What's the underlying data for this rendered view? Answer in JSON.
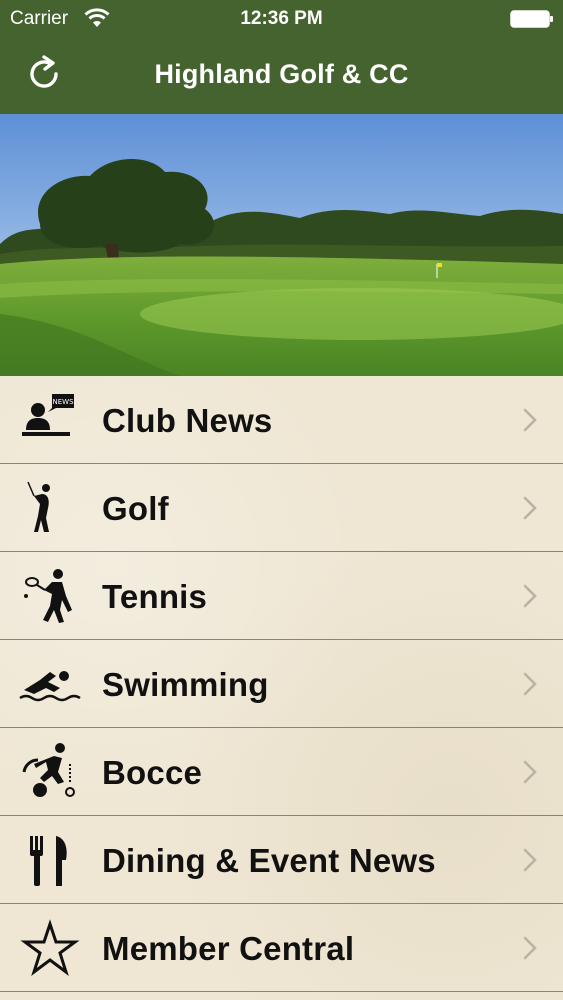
{
  "status_bar": {
    "carrier": "Carrier",
    "time": "12:36 PM",
    "wifi_icon": "wifi-icon",
    "battery_icon": "battery-icon"
  },
  "nav_bar": {
    "title": "Highland Golf & CC",
    "refresh_icon": "refresh-icon",
    "color": "#45632e"
  },
  "hero": {
    "image": "golf-course-photo"
  },
  "menu": {
    "items": [
      {
        "label": "Club News",
        "icon": "news-icon"
      },
      {
        "label": "Golf",
        "icon": "golfer-icon"
      },
      {
        "label": "Tennis",
        "icon": "tennis-player-icon"
      },
      {
        "label": "Swimming",
        "icon": "swimmer-icon"
      },
      {
        "label": "Bocce",
        "icon": "bocce-player-icon"
      },
      {
        "label": "Dining & Event News",
        "icon": "fork-knife-icon"
      },
      {
        "label": "Member Central",
        "icon": "star-icon"
      }
    ],
    "chevron_icon": "chevron-right-icon"
  }
}
